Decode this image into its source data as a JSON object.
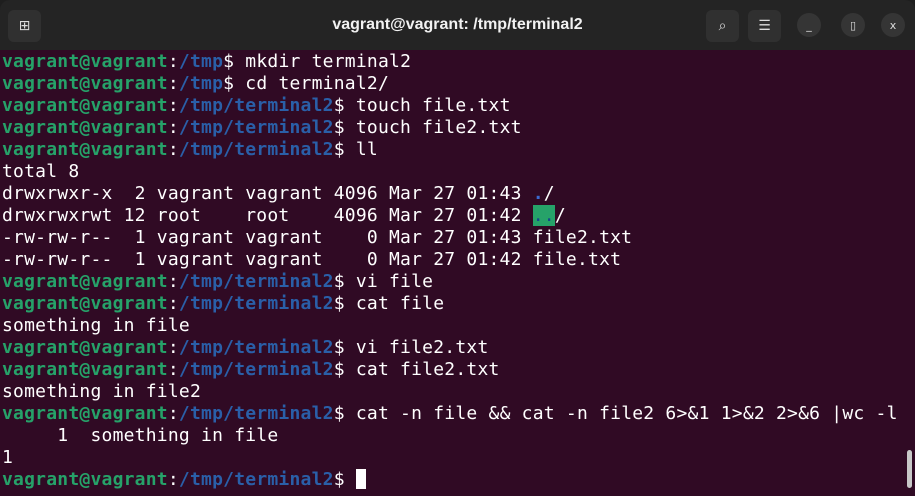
{
  "window": {
    "title": "vagrant@vagrant: /tmp/terminal2",
    "buttons": {
      "new_tab": "new-tab-icon",
      "search": "search-icon",
      "menu": "hamburger-menu-icon",
      "minimize": "minimize-icon",
      "maximize": "maximize-icon",
      "close": "close-icon"
    }
  },
  "colors": {
    "background": "#300a24",
    "prompt_user": "#26a269",
    "prompt_path": "#2a5fa8",
    "titlebar": "#242424"
  },
  "terminal": {
    "lines": [
      [
        [
          "u",
          "vagrant@vagrant"
        ],
        [
          "c",
          ":"
        ],
        [
          "p",
          "/tmp"
        ],
        [
          "c",
          "$ mkdir terminal2"
        ]
      ],
      [
        [
          "u",
          "vagrant@vagrant"
        ],
        [
          "c",
          ":"
        ],
        [
          "p",
          "/tmp"
        ],
        [
          "c",
          "$ cd terminal2/"
        ]
      ],
      [
        [
          "u",
          "vagrant@vagrant"
        ],
        [
          "c",
          ":"
        ],
        [
          "p",
          "/tmp/terminal2"
        ],
        [
          "c",
          "$ touch file.txt"
        ]
      ],
      [
        [
          "u",
          "vagrant@vagrant"
        ],
        [
          "c",
          ":"
        ],
        [
          "p",
          "/tmp/terminal2"
        ],
        [
          "c",
          "$ touch file2.txt"
        ]
      ],
      [
        [
          "u",
          "vagrant@vagrant"
        ],
        [
          "c",
          ":"
        ],
        [
          "p",
          "/tmp/terminal2"
        ],
        [
          "c",
          "$ ll"
        ]
      ],
      [
        [
          "c",
          "total 8"
        ]
      ],
      [
        [
          "c",
          "drwxrwxr-x  2 vagrant vagrant 4096 Mar 27 01:43 "
        ],
        [
          "dirb",
          "."
        ],
        [
          "c",
          "/"
        ]
      ],
      [
        [
          "c",
          "drwxrwxrwt 12 root    root    4096 Mar 27 01:42 "
        ],
        [
          "hl",
          ".."
        ],
        [
          "c",
          "/"
        ]
      ],
      [
        [
          "c",
          "-rw-rw-r--  1 vagrant vagrant    0 Mar 27 01:43 file2.txt"
        ]
      ],
      [
        [
          "c",
          "-rw-rw-r--  1 vagrant vagrant    0 Mar 27 01:42 file.txt"
        ]
      ],
      [
        [
          "u",
          "vagrant@vagrant"
        ],
        [
          "c",
          ":"
        ],
        [
          "p",
          "/tmp/terminal2"
        ],
        [
          "c",
          "$ vi file"
        ]
      ],
      [
        [
          "u",
          "vagrant@vagrant"
        ],
        [
          "c",
          ":"
        ],
        [
          "p",
          "/tmp/terminal2"
        ],
        [
          "c",
          "$ cat file"
        ]
      ],
      [
        [
          "c",
          "something in file"
        ]
      ],
      [
        [
          "u",
          "vagrant@vagrant"
        ],
        [
          "c",
          ":"
        ],
        [
          "p",
          "/tmp/terminal2"
        ],
        [
          "c",
          "$ vi file2.txt"
        ]
      ],
      [
        [
          "u",
          "vagrant@vagrant"
        ],
        [
          "c",
          ":"
        ],
        [
          "p",
          "/tmp/terminal2"
        ],
        [
          "c",
          "$ cat file2.txt"
        ]
      ],
      [
        [
          "c",
          "something in file2"
        ]
      ],
      [
        [
          "u",
          "vagrant@vagrant"
        ],
        [
          "c",
          ":"
        ],
        [
          "p",
          "/tmp/terminal2"
        ],
        [
          "c",
          "$ cat -n file && cat -n file2 6>&1 1>&2 2>&6 |wc -l"
        ]
      ],
      [
        [
          "c",
          "     1  something in file"
        ]
      ],
      [
        [
          "c",
          "1"
        ]
      ],
      [
        [
          "u",
          "vagrant@vagrant"
        ],
        [
          "c",
          ":"
        ],
        [
          "p",
          "/tmp/terminal2"
        ],
        [
          "c",
          "$ "
        ]
      ]
    ]
  }
}
